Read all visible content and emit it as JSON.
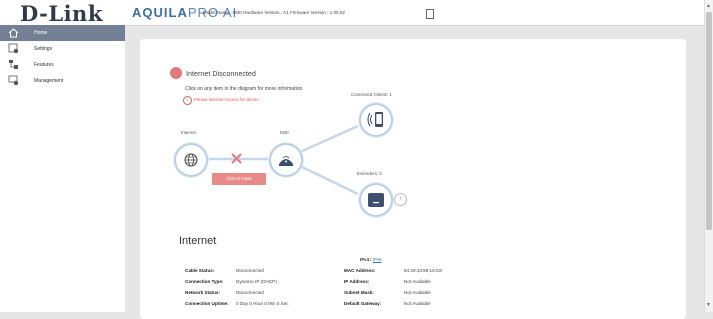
{
  "header": {
    "logo": "D-Link",
    "brand_aquila": "AQUILA",
    "brand_pro": "PRO AI",
    "meta": "Model Name : M30 Hardware Version : A1 Firmware Version : 1.00.02"
  },
  "sidebar": {
    "items": [
      {
        "label": "Home",
        "icon": "house-icon"
      },
      {
        "label": "Settings",
        "icon": "settings-icon"
      },
      {
        "label": "Features",
        "icon": "features-icon"
      },
      {
        "label": "Management",
        "icon": "management-icon"
      }
    ]
  },
  "main": {
    "status": "Internet Disconnected",
    "hint": "Click on any item in the diagram for more information.",
    "alert_count": "1",
    "alert_text": "Please Internet Access for clients",
    "diagram": {
      "internet_label": "Internet",
      "router_label": "M30",
      "clients_label": "Connected Clients: 1",
      "extenders_label": "Extenders: 0",
      "repair_button": "Click to repair"
    },
    "section_title": "Internet",
    "ipv4": "IPv4",
    "slash": "/",
    "ipv6": "IPv6",
    "left_rows": [
      {
        "key": "Cable Status:",
        "value": "Disconnected"
      },
      {
        "key": "Connection Type:",
        "value": "Dynamic IP (DHCP)"
      },
      {
        "key": "Network Status:",
        "value": "Disconnected"
      },
      {
        "key": "Connection Uptime:",
        "value": "0 Day 0 Hour 0 Min 0 Sec"
      }
    ],
    "right_rows": [
      {
        "key": "MAC Address:",
        "value": "84:29:43:99:16:CE"
      },
      {
        "key": "IP Address:",
        "value": "Not Available"
      },
      {
        "key": "Subnet Mask:",
        "value": "Not Available"
      },
      {
        "key": "Default Gateway:",
        "value": "Not Available"
      }
    ]
  },
  "colors": {
    "accent": "#3b6ea8",
    "sidebar_active": "#737f92",
    "disconnected": "#e07b7b",
    "node_border": "#b9cfe6",
    "link": "#c5d7ea"
  }
}
